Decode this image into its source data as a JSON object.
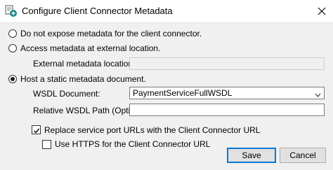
{
  "window": {
    "title": "Configure Client Connector Metadata",
    "icon": "client-connector-icon",
    "close_icon": "close-icon"
  },
  "options": {
    "no_expose": {
      "label": "Do not expose metadata for the client connector.",
      "checked": false
    },
    "external": {
      "label": "Access metadata at external location.",
      "checked": false
    },
    "static": {
      "label": "Host a static metadata document.",
      "checked": true
    }
  },
  "external_location": {
    "label": "External metadata location:",
    "value": "",
    "enabled": false
  },
  "wsdl_document": {
    "label": "WSDL Document:",
    "value": "PaymentServiceFullWSDL"
  },
  "relative_wsdl_path": {
    "label": "Relative WSDL Path (Optional):",
    "value": ""
  },
  "replace_urls": {
    "label": "Replace service port URLs with the Client Connector URL",
    "checked": true
  },
  "use_https": {
    "label": "Use HTTPS for the Client Connector URL",
    "checked": false
  },
  "buttons": {
    "save": "Save",
    "cancel": "Cancel"
  },
  "colors": {
    "dialog_background": "#f0f0f0",
    "default_button_border": "#0078d7",
    "icon_teal": "#1f8a8a"
  }
}
